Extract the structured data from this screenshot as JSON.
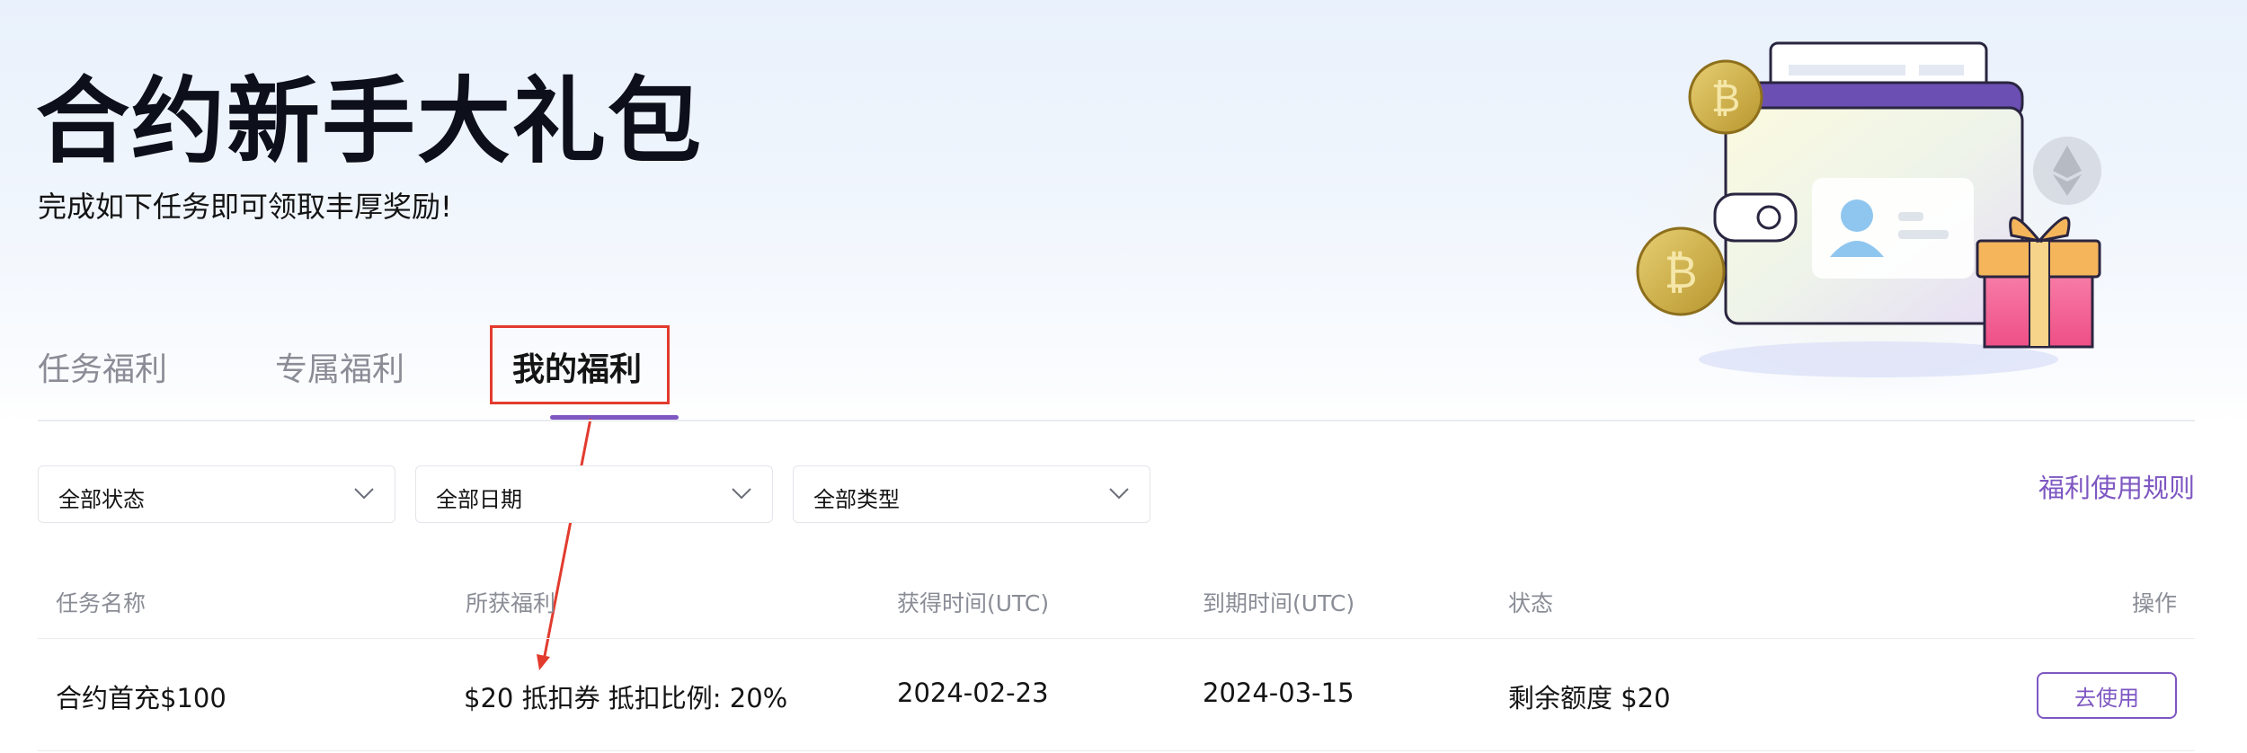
{
  "hero": {
    "title": "合约新手大礼包",
    "subtitle": "完成如下任务即可领取丰厚奖励!"
  },
  "tabs": [
    {
      "label": "任务福利",
      "active": false
    },
    {
      "label": "专属福利",
      "active": false
    },
    {
      "label": "我的福利",
      "active": true
    }
  ],
  "filters": [
    {
      "label": "全部状态",
      "icon": "chevron-down-icon"
    },
    {
      "label": "全部日期",
      "icon": "chevron-down-icon"
    },
    {
      "label": "全部类型",
      "icon": "chevron-down-icon"
    }
  ],
  "rules_link": "福利使用规则",
  "table": {
    "columns": [
      "任务名称",
      "所获福利",
      "获得时间(UTC)",
      "到期时间(UTC)",
      "状态",
      "操作"
    ],
    "rows": [
      {
        "task_name": "合约首充$100",
        "reward": "$20 抵扣券 抵扣比例: 20%",
        "obtained_time": "2024-02-23",
        "expire_time": "2024-03-15",
        "status": "剩余额度 $20",
        "action": "去使用"
      }
    ]
  },
  "colors": {
    "accent": "#7e57c2",
    "annotation": "#e23b2e",
    "muted_text": "#8a8d96"
  }
}
